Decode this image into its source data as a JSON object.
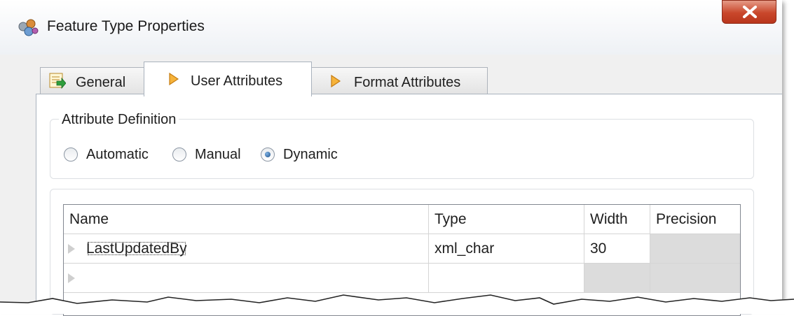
{
  "window": {
    "title": "Feature Type Properties"
  },
  "tabs": [
    {
      "label": "General",
      "icon": "general-icon"
    },
    {
      "label": "User Attributes",
      "icon": "diamond-icon"
    },
    {
      "label": "Format Attributes",
      "icon": "diamond-icon"
    }
  ],
  "active_tab": "User Attributes",
  "attribute_definition": {
    "title": "Attribute Definition",
    "options": [
      "Automatic",
      "Manual",
      "Dynamic"
    ],
    "selected": "Dynamic"
  },
  "table": {
    "columns": [
      "Name",
      "Type",
      "Width",
      "Precision"
    ],
    "rows": [
      {
        "name": "LastUpdatedBy",
        "type": "xml_char",
        "width": "30",
        "precision": ""
      },
      {
        "name": "",
        "type": "",
        "width": "",
        "precision": ""
      }
    ]
  },
  "colors": {
    "accent": "#1c4f86",
    "close_button": "#c9472b",
    "tab_icon": "#f0a020"
  }
}
